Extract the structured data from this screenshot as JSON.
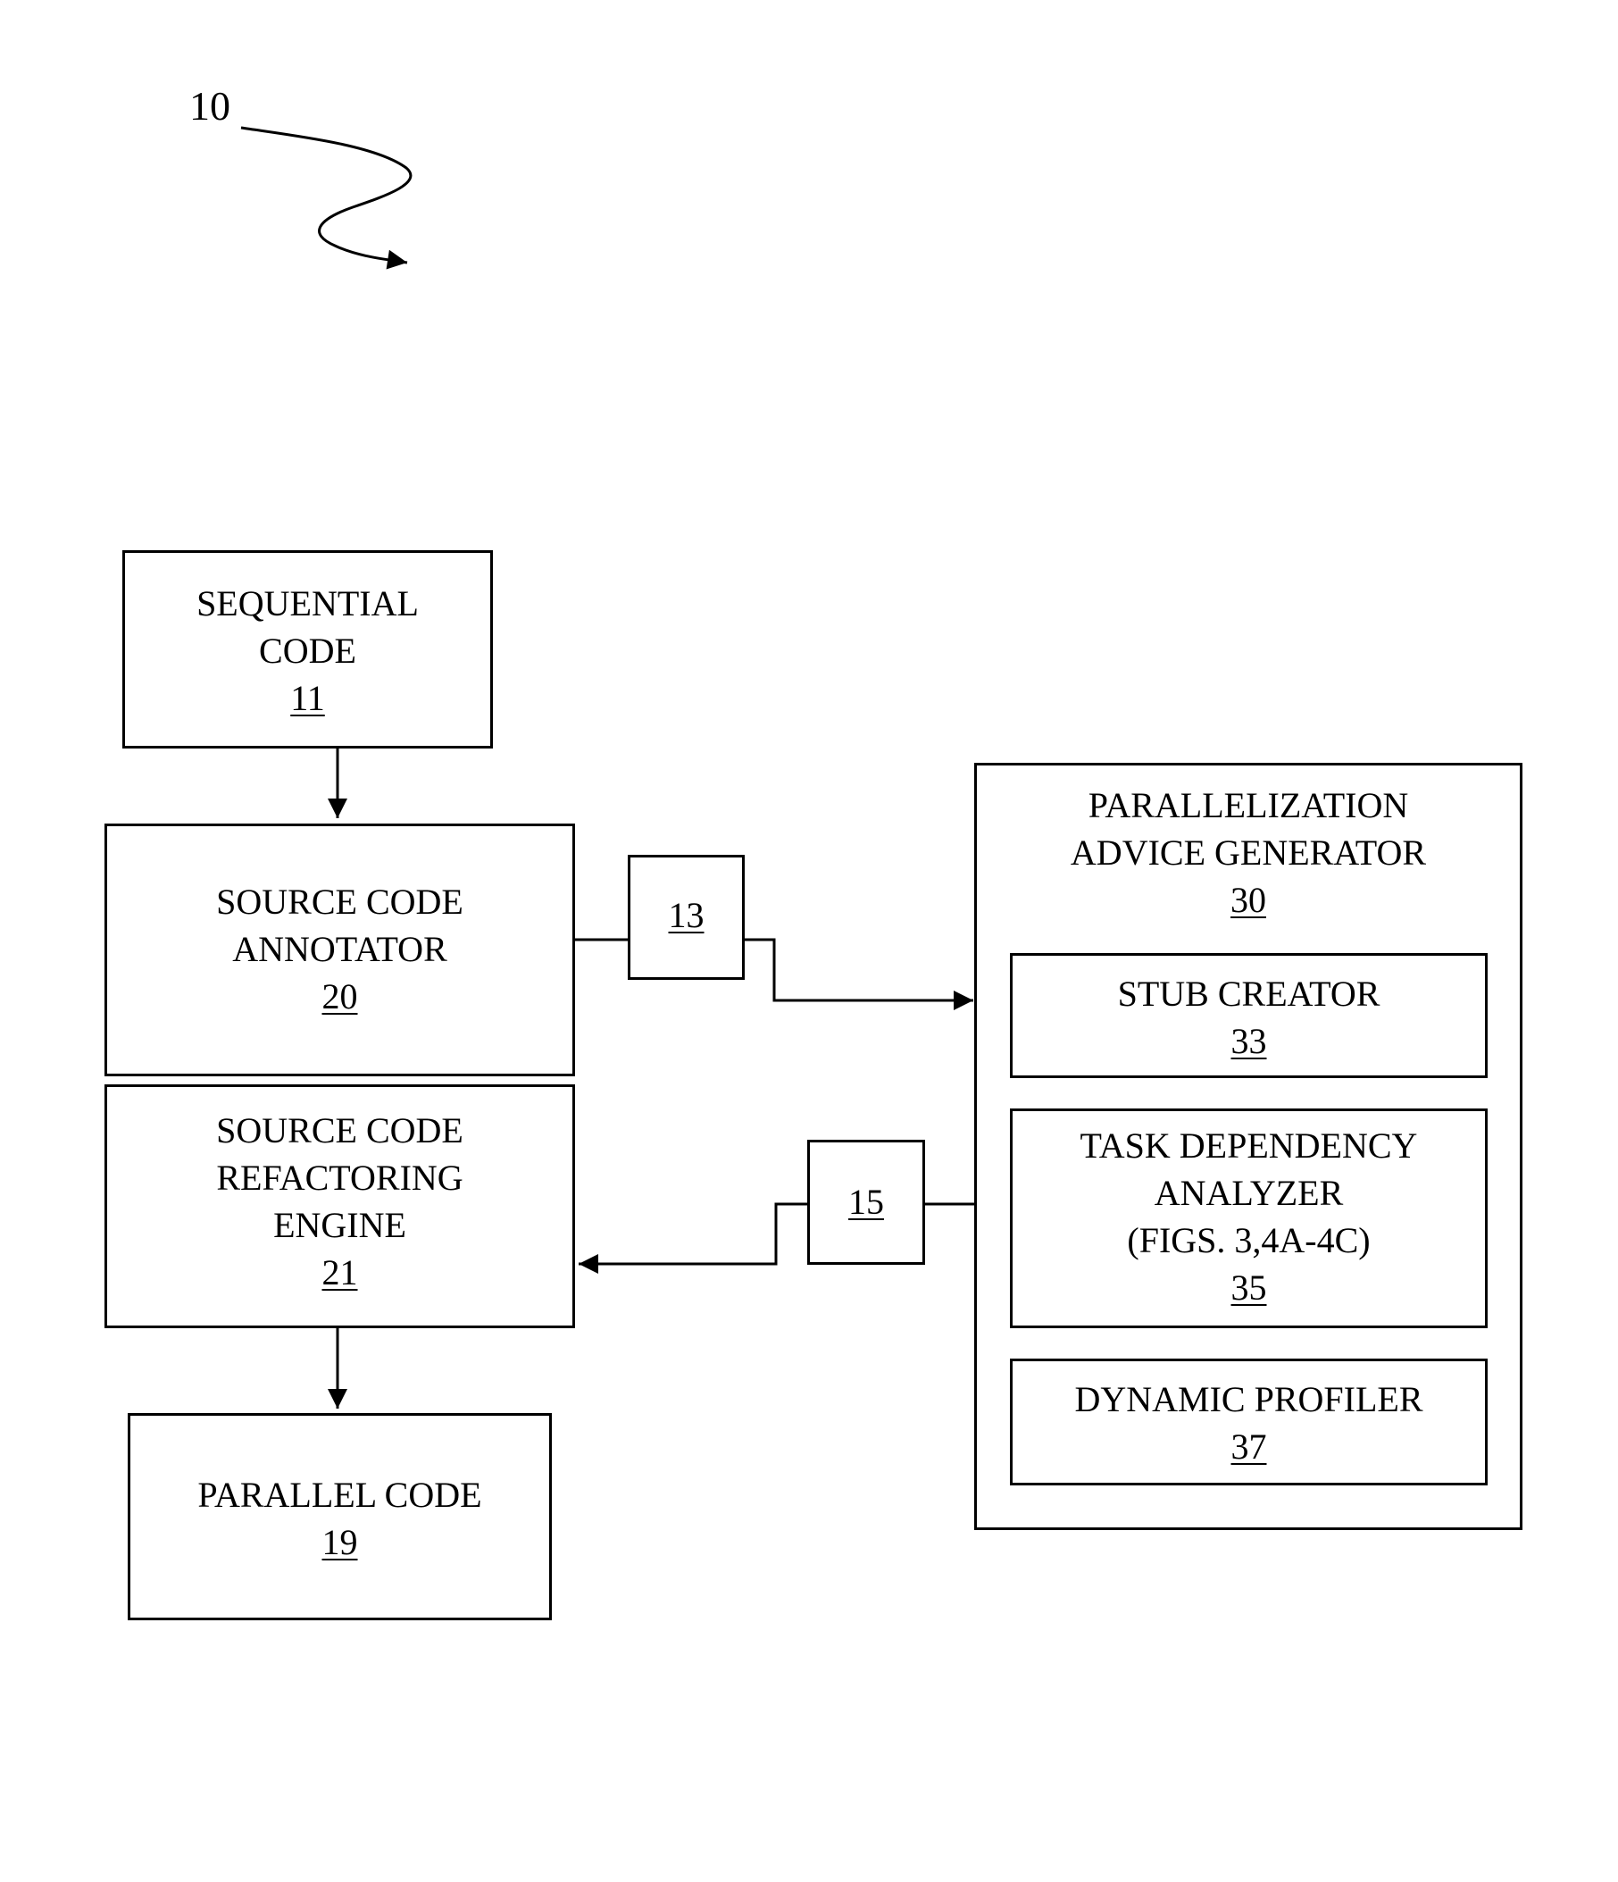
{
  "figure": {
    "reference_numeral": "10"
  },
  "blocks": {
    "sequential_code": {
      "lines": [
        "SEQUENTIAL",
        "CODE"
      ],
      "ref": "11"
    },
    "source_code_annotator": {
      "lines": [
        "SOURCE CODE",
        "ANNOTATOR"
      ],
      "ref": "20"
    },
    "refactoring_engine": {
      "lines": [
        "SOURCE CODE",
        "REFACTORING",
        "ENGINE"
      ],
      "ref": "21"
    },
    "parallel_code": {
      "lines": [
        "PARALLEL CODE"
      ],
      "ref": "19"
    },
    "advice_generator": {
      "lines": [
        "PARALLELIZATION",
        "ADVICE GENERATOR"
      ],
      "ref": "30"
    },
    "stub_creator": {
      "lines": [
        "STUB CREATOR"
      ],
      "ref": "33"
    },
    "task_dependency_analyzer": {
      "lines": [
        "TASK DEPENDENCY",
        "ANALYZER",
        "(FIGS. 3,4A-4C)"
      ],
      "ref": "35"
    },
    "dynamic_profiler": {
      "lines": [
        "DYNAMIC PROFILER"
      ],
      "ref": "37"
    },
    "data_13": {
      "ref": "13"
    },
    "data_15": {
      "ref": "15"
    }
  },
  "connections": [
    {
      "from": "sequential_code",
      "to": "source_code_annotator"
    },
    {
      "from": "source_code_annotator",
      "via": "data_13",
      "to": "advice_generator"
    },
    {
      "from": "advice_generator",
      "via": "data_15",
      "to": "refactoring_engine"
    },
    {
      "from": "refactoring_engine",
      "to": "parallel_code"
    }
  ]
}
